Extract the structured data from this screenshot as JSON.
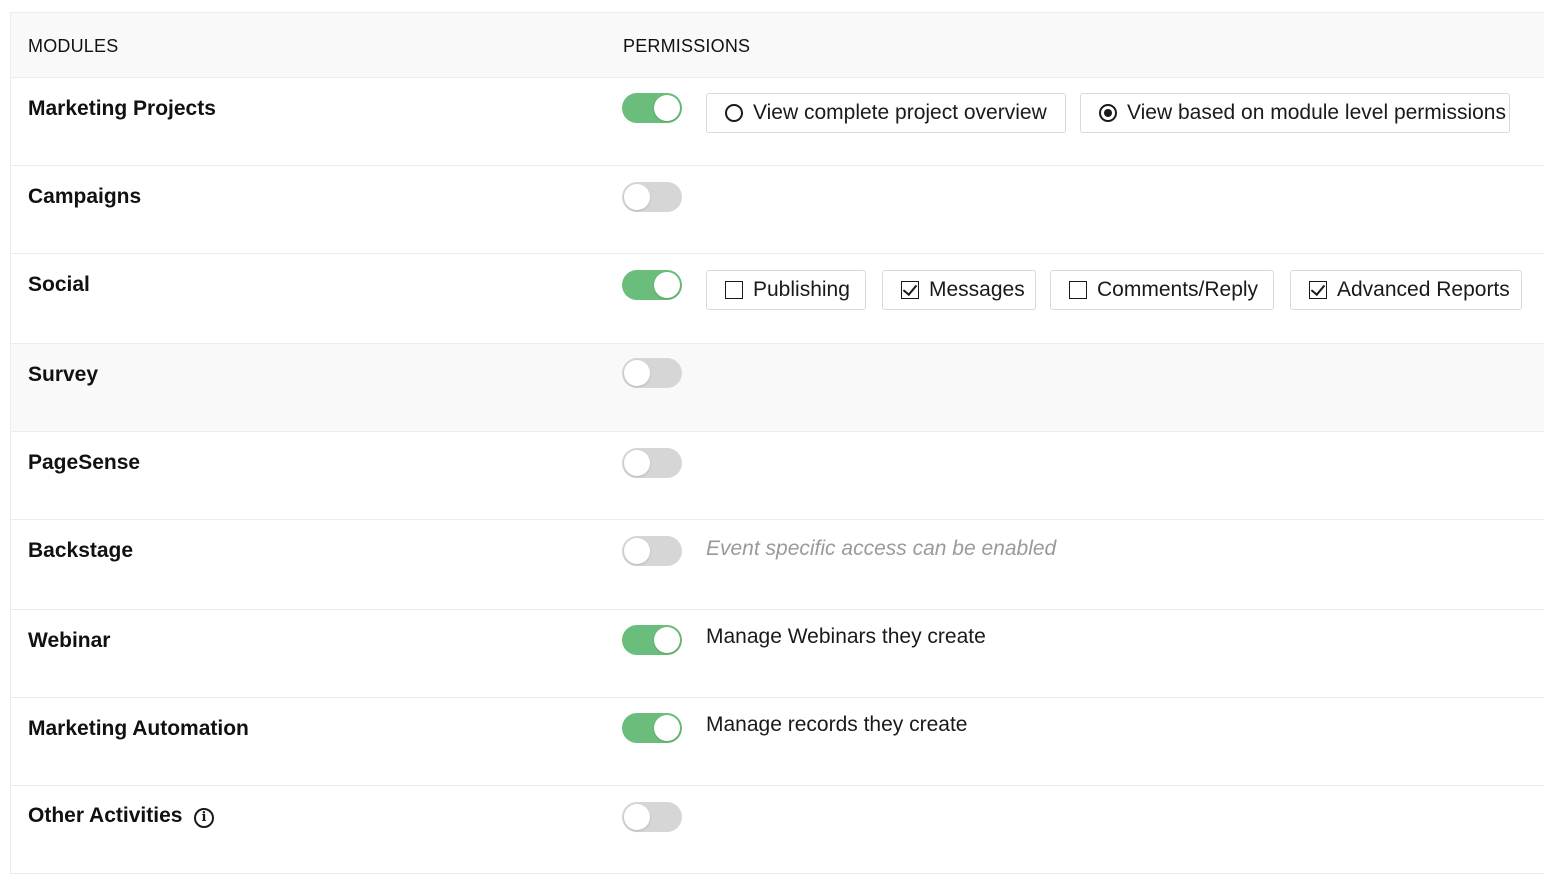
{
  "header": {
    "modules_label": "MODULES",
    "permissions_label": "PERMISSIONS"
  },
  "rows": {
    "marketing_projects": {
      "name": "Marketing Projects",
      "enabled": true,
      "options": [
        {
          "type": "radio",
          "label": "View complete project overview",
          "selected": false
        },
        {
          "type": "radio",
          "label": "View based on module level permissions",
          "selected": true
        }
      ]
    },
    "campaigns": {
      "name": "Campaigns",
      "enabled": false
    },
    "social": {
      "name": "Social",
      "enabled": true,
      "options": [
        {
          "type": "checkbox",
          "label": "Publishing",
          "selected": false
        },
        {
          "type": "checkbox",
          "label": "Messages",
          "selected": true
        },
        {
          "type": "checkbox",
          "label": "Comments/Reply",
          "selected": false
        },
        {
          "type": "checkbox",
          "label": "Advanced Reports",
          "selected": true
        }
      ]
    },
    "survey": {
      "name": "Survey",
      "enabled": false
    },
    "pagesense": {
      "name": "PageSense",
      "enabled": false
    },
    "backstage": {
      "name": "Backstage",
      "enabled": false,
      "note": "Event specific access can be enabled"
    },
    "webinar": {
      "name": "Webinar",
      "enabled": true,
      "note": "Manage Webinars they create"
    },
    "marketing_automation": {
      "name": "Marketing Automation",
      "enabled": true,
      "note": "Manage records they create"
    },
    "other_activities": {
      "name": "Other Activities",
      "enabled": false,
      "info_icon": "info-icon",
      "info_glyph": "i"
    }
  },
  "colors": {
    "toggle_on": "#6abd7b",
    "toggle_off": "#d6d6d6",
    "muted_text": "#9a9a9a",
    "row_alt_bg": "#f9f9f9"
  }
}
